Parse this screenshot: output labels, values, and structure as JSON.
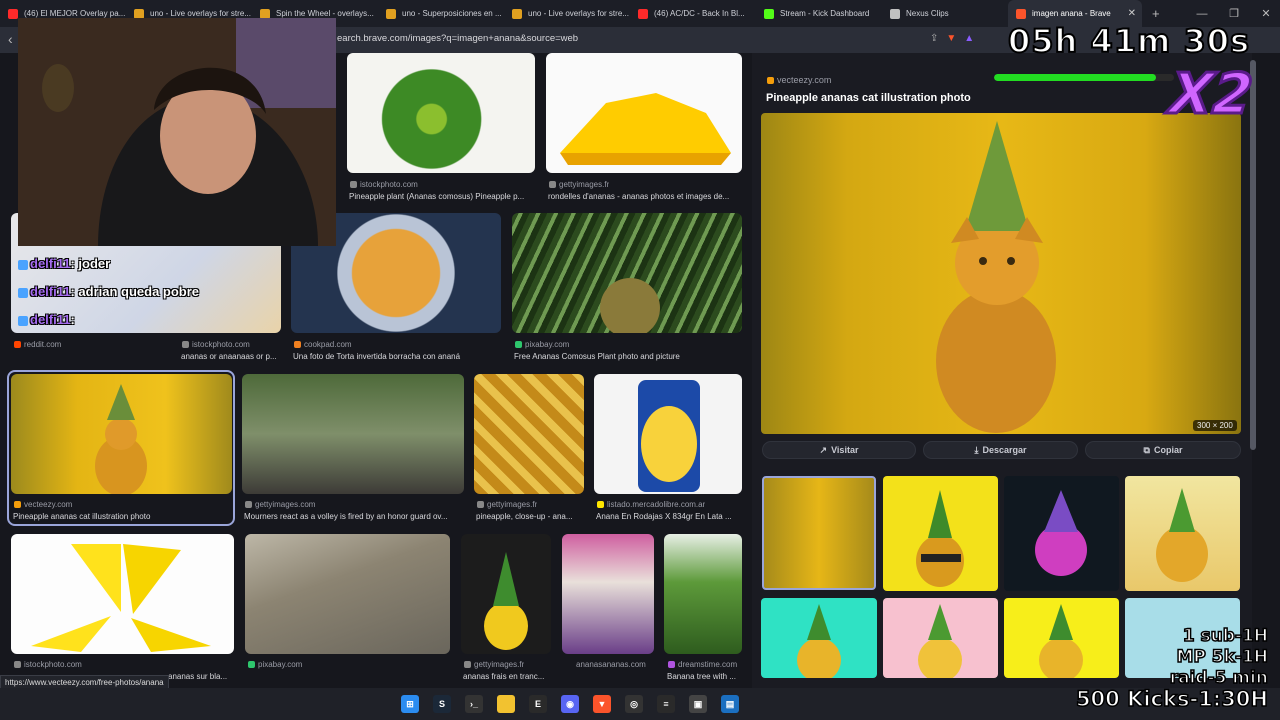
{
  "tabs": [
    {
      "label": "(46) El MEJOR Overlay pa...",
      "color": "#ff2a2a"
    },
    {
      "label": "uno - Live overlays for stre...",
      "color": "#e0a020"
    },
    {
      "label": "Spin the Wheel - overlays...",
      "color": "#e0a020"
    },
    {
      "label": "uno - Superposiciones en ...",
      "color": "#e0a020"
    },
    {
      "label": "uno - Live overlays for stre...",
      "color": "#e0a020"
    },
    {
      "label": "(46) AC/DC - Back In Bl...",
      "color": "#ff2a2a"
    },
    {
      "label": "Stream - Kick Dashboard",
      "color": "#53fc18"
    },
    {
      "label": "Nexus Clips",
      "color": "#c0c0c0"
    },
    {
      "label": "imagen anana - Brave",
      "color": "#fb542b",
      "active": true
    }
  ],
  "address": {
    "url": "earch.brave.com/images?q=imagen+anana&source=web"
  },
  "grid": [
    {
      "source": "istockphoto.com",
      "caption": "Pineapple plant (Ananas comosus) Pineapple p...",
      "src_color": "#888"
    },
    {
      "source": "gettyimages.fr",
      "caption": "rondelles d'ananas - ananas photos et images de...",
      "src_color": "#888"
    },
    {
      "source": "reddit.com",
      "caption": "",
      "src_color": "#ff4500"
    },
    {
      "source": "istockphoto.com",
      "caption": "ananas or anaanaas or p...",
      "src_color": "#888"
    },
    {
      "source": "cookpad.com",
      "caption": "Una foto de Torta invertida borracha con ananá",
      "src_color": "#f08020"
    },
    {
      "source": "pixabay.com",
      "caption": "Free Ananas Comosus Plant photo and picture",
      "src_color": "#2ec66d"
    },
    {
      "source": "vecteezy.com",
      "caption": "Pineapple ananas cat illustration photo",
      "src_color": "#f59e0b"
    },
    {
      "source": "gettyimages.com",
      "caption": "Mourners react as a volley is fired by an honor guard ov...",
      "src_color": "#888"
    },
    {
      "source": "gettyimages.fr",
      "caption": "pineapple, close-up - ana...",
      "src_color": "#888"
    },
    {
      "source": "listado.mercadolibre.com.ar",
      "caption": "Anana En Rodajas X 834gr En Lata ...",
      "src_color": "#ffe600"
    },
    {
      "source": "istockphoto.com",
      "caption": "",
      "src_color": "#888"
    },
    {
      "source": "",
      "caption": "ananas sur bla...",
      "src_color": "#888"
    },
    {
      "source": "pixabay.com",
      "caption": "",
      "src_color": "#2ec66d"
    },
    {
      "source": "gettyimages.fr",
      "caption": "ananas frais en tranc...",
      "src_color": "#888"
    },
    {
      "source": "ananasananas.com",
      "caption": "",
      "src_color": "#888"
    },
    {
      "source": "dreamstime.com",
      "caption": "Banana tree with ...",
      "src_color": "#b054e0"
    }
  ],
  "detail": {
    "source": "vecteezy.com",
    "title": "Pineapple ananas cat illustration photo",
    "dimensions": "300 × 200",
    "visit_label": "Visitar",
    "download_label": "Descargar",
    "copy_label": "Copiar"
  },
  "status_url": "https://www.vecteezy.com/free-photos/anana",
  "chat": [
    {
      "user": "delfi11",
      "message": ": joder"
    },
    {
      "user": "delfi11",
      "message": ": adrian queda pobre"
    },
    {
      "user": "delfi11",
      "message": ":"
    }
  ],
  "stream_overlay": {
    "timer": "05h 41m 30s",
    "multiplier": "X2",
    "progress": 0.9,
    "goals": [
      "1 sub-1H",
      "MP 5k-1H",
      "raid-5 min",
      "500 Kicks-1:30H"
    ]
  },
  "colors": {
    "accent": "#9aa5d9",
    "brave": "#fb542b",
    "kick": "#53fc18"
  }
}
